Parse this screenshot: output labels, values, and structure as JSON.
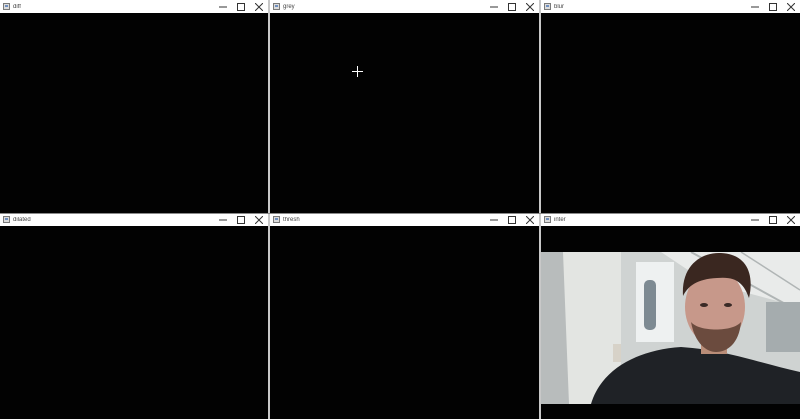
{
  "windows": [
    {
      "title": "diff"
    },
    {
      "title": "grey"
    },
    {
      "title": "blur"
    },
    {
      "title": "dilated"
    },
    {
      "title": "thresh"
    },
    {
      "title": "inter"
    }
  ],
  "controls": {
    "minimize_icon": "minimize-icon",
    "maximize_icon": "maximize-icon",
    "close_icon": "close-icon"
  },
  "colors": {
    "canvas": "#000000",
    "titlebar": "#ffffff"
  }
}
